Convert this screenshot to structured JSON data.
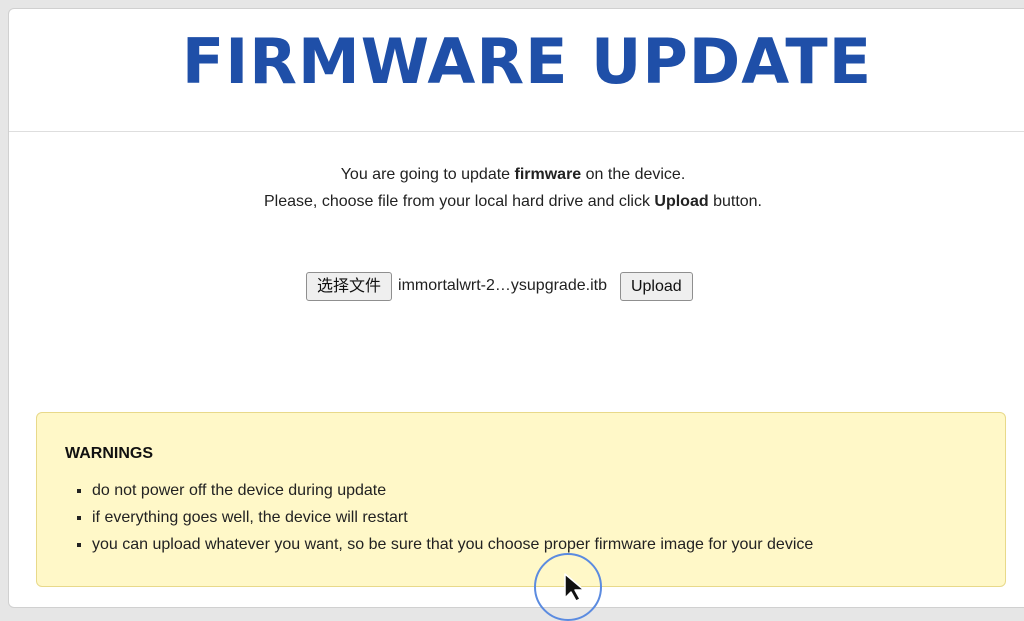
{
  "header": {
    "title": "FIRMWARE UPDATE"
  },
  "intro": {
    "line1_prefix": "You are going to update ",
    "line1_bold": "firmware",
    "line1_suffix": " on the device.",
    "line2_prefix": "Please, choose file from your local hard drive and click ",
    "line2_bold": "Upload",
    "line2_suffix": " button."
  },
  "form": {
    "choose_file_label": "选择文件",
    "file_name": "immortalwrt-2…ysupgrade.itb",
    "upload_label": "Upload"
  },
  "warnings": {
    "heading": "WARNINGS",
    "items": [
      "do not power off the device during update",
      "if everything goes well, the device will restart",
      "you can upload whatever you want, so be sure that you choose proper firmware image for your device"
    ]
  },
  "colors": {
    "title": "#1f4fa8",
    "warning_bg": "#fff8c8",
    "warning_border": "#e8d98a"
  },
  "icons": {
    "cursor": "mouse-pointer-icon"
  }
}
